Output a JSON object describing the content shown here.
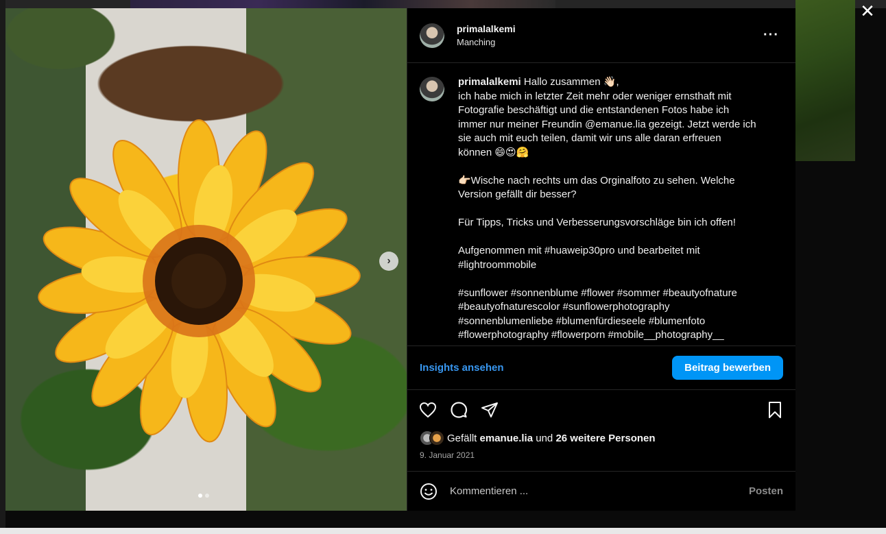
{
  "close_label": "✕",
  "post": {
    "username": "primalalkemi",
    "location": "Manching",
    "more_label": "···",
    "caption_lines": [
      "Hallo zusammen 👋🏻,",
      "ich habe mich in letzter Zeit mehr oder weniger ernsthaft mit",
      "Fotografie beschäftigt und die entstandenen Fotos habe ich",
      "immer nur meiner Freundin @emanue.lia gezeigt. Jetzt werde ich",
      "sie auch mit euch teilen, damit wir uns alle daran erfreuen",
      "können 😄😍🤗",
      "",
      "👉🏻Wische nach rechts um das Orginalfoto zu sehen. Welche",
      "Version gefällt dir besser?",
      "",
      "Für Tipps, Tricks und Verbesserungsvorschläge bin ich offen!",
      "",
      "Aufgenommen mit #huaweip30pro und bearbeitet mit",
      "#lightroommobile",
      "",
      "#sunflower #sonnenblume #flower #sommer #beautyofnature",
      "#beautyofnaturescolor #sunflowerphotography",
      "#sonnenblumenliebe #blumenfürdieseele #blumenfoto",
      "#flowerphotography #flowerporn #mobile__photography__"
    ],
    "insights_label": "Insights ansehen",
    "promote_label": "Beitrag bewerben",
    "likes": {
      "prefix": "Gefällt",
      "liker": "emanue.lia",
      "connector": "und",
      "others": "26 weitere Personen"
    },
    "date": "9. Januar 2021",
    "comment_placeholder": "Kommentieren ...",
    "post_label": "Posten",
    "carousel": {
      "current": 1,
      "total": 2
    }
  },
  "colors": {
    "accent": "#0095f6",
    "link": "#3897f0",
    "background": "#000000"
  }
}
